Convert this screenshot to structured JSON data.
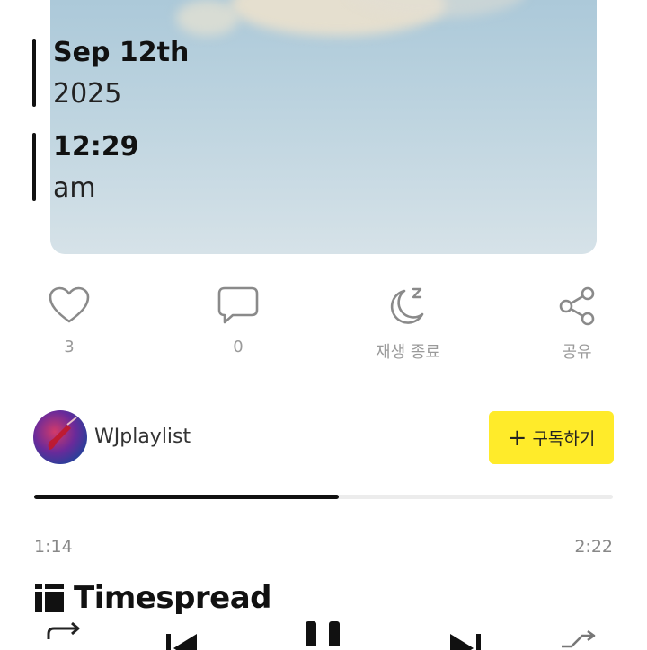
{
  "date_stamp": {
    "date": "Sep 12th",
    "year": "2025",
    "time": "12:29",
    "ampm": "am"
  },
  "actions": [
    {
      "icon": "heart-icon",
      "label": "3"
    },
    {
      "icon": "comment-icon",
      "label": "0"
    },
    {
      "icon": "sleep-timer-icon",
      "label": "재생 종료"
    },
    {
      "icon": "share-icon",
      "label": "공유"
    }
  ],
  "channel": {
    "name": "WJplaylist",
    "subscribe_label": "구독하기"
  },
  "playback": {
    "elapsed": "1:14",
    "duration": "2:22",
    "progress": 0.527
  },
  "brand": {
    "name": "Timespread"
  },
  "controls": [
    "repeat-icon",
    "previous-icon",
    "pause-icon",
    "next-icon",
    "shuffle-icon"
  ],
  "colors": {
    "subscribe_bg": "#ffeb2a",
    "progress_fill": "#111111",
    "icon_gray": "#9a9a9a"
  }
}
